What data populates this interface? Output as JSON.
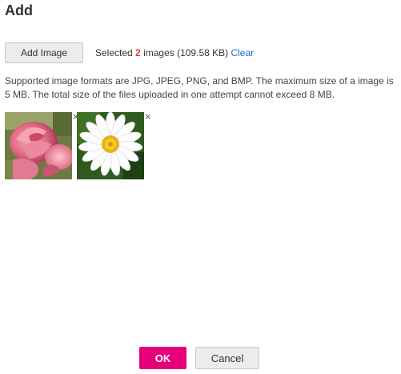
{
  "dialog": {
    "title": "Add",
    "add_image_label": "Add Image",
    "selected_prefix": "Selected ",
    "selected_count": "2",
    "selected_suffix": " images (109.58 KB) ",
    "clear_label": "Clear",
    "hint": "Supported image formats are JPG, JPEG, PNG, and BMP. The maximum size of a image is 5 MB. The total size of the files uploaded in one attempt cannot exceed 8 MB.",
    "remove_glyph": "×",
    "ok_label": "OK",
    "cancel_label": "Cancel"
  },
  "colors": {
    "accent": "#e5007a",
    "count": "#e4393c",
    "link": "#1a6fc9"
  },
  "thumbnails": [
    {
      "subject": "pink-roses"
    },
    {
      "subject": "white-daisy"
    }
  ]
}
